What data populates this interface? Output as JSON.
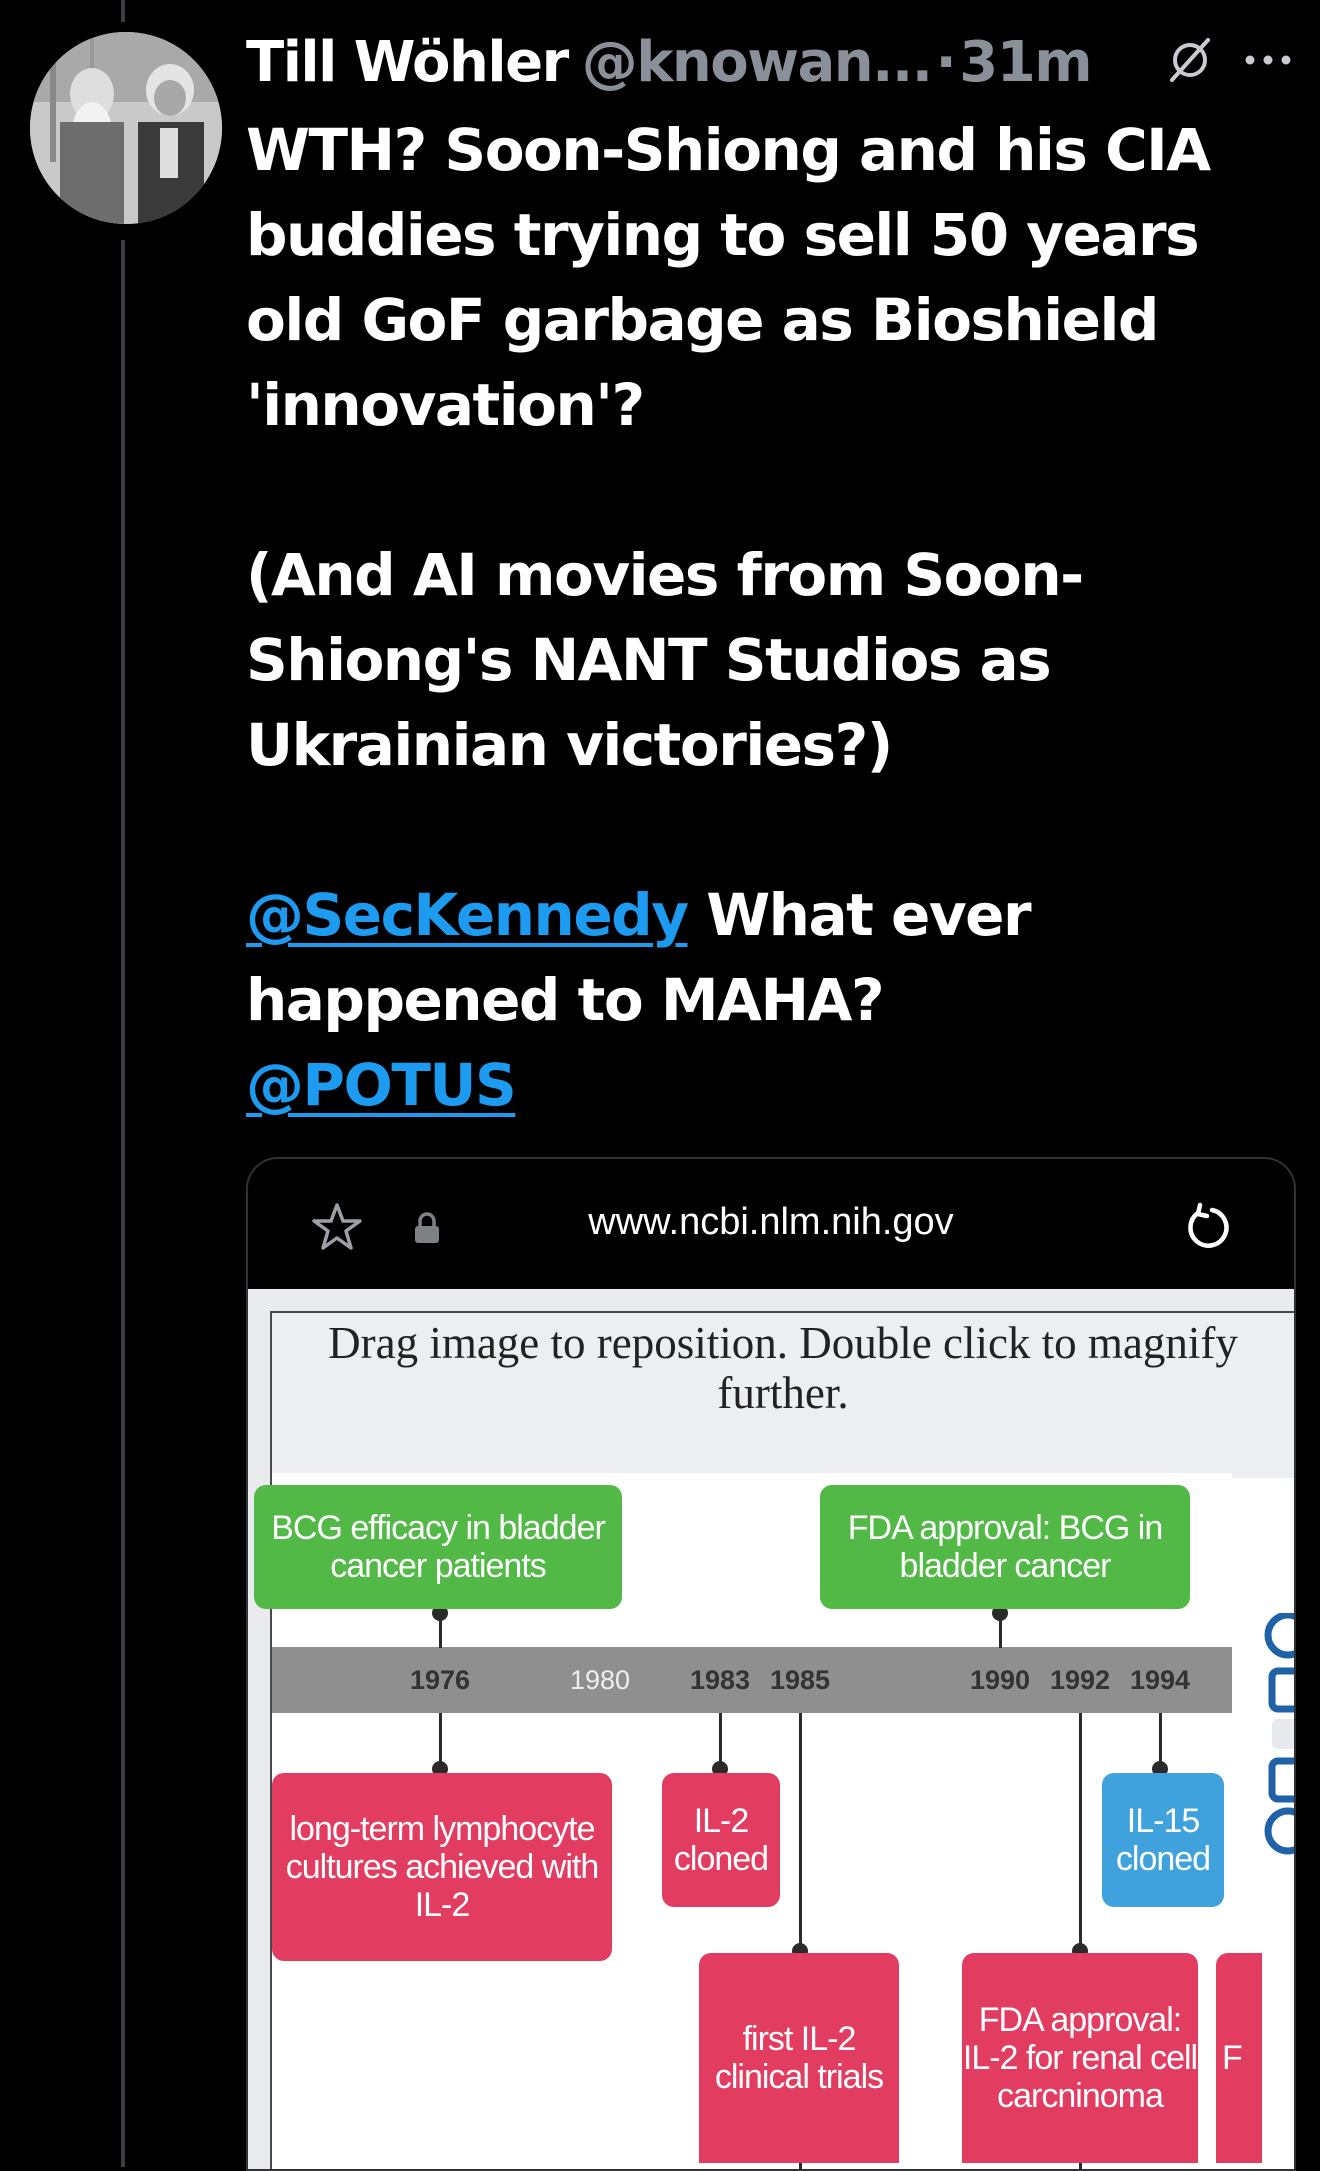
{
  "tweet": {
    "author_name": "Till Wöhler",
    "handle": "@knowan...",
    "separator": "·",
    "time": "31m",
    "paragraphs": [
      "WTH? Soon-Shiong and his CIA buddies trying to sell 50 years old GoF garbage as Bioshield 'innovation'?",
      "(And AI movies from Soon-Shiong's NANT Studios as Ukrainian victories?)"
    ],
    "mention1": "@SecKennedy",
    "mention_tail": "What ever happened to MAHA?",
    "mention2": "@POTUS"
  },
  "browser": {
    "url": "www.ncbi.nlm.nih.gov"
  },
  "viewer": {
    "hint": "Drag image to reposition. Double click to magnify further."
  },
  "timeline": {
    "years": [
      "1976",
      "1980",
      "1983",
      "1985",
      "1990",
      "1992",
      "1994"
    ],
    "top_events": [
      {
        "label": "BCG efficacy in bladder cancer patients",
        "year": "1976"
      },
      {
        "label": "FDA approval: BCG in bladder cancer",
        "year": "1990"
      }
    ],
    "bottom_events": [
      {
        "label": "long-term lymphocyte cultures achieved with IL-2",
        "year": "1976"
      },
      {
        "label": "IL-2 cloned",
        "year": "1983"
      },
      {
        "label": "IL-15 cloned",
        "year": "1994"
      },
      {
        "label": "first IL-2 clinical trials",
        "year": "1985"
      },
      {
        "label": "FDA approval: IL-2 for renal cell carcninoma",
        "year": "1992"
      },
      {
        "label": "F",
        "year": ""
      }
    ]
  },
  "icons": {
    "grok": "slashed-circle-icon",
    "more": "more-dots-icon",
    "star": "star-outline-icon",
    "lock": "lock-icon",
    "reload": "reload-icon"
  },
  "colors": {
    "background": "#000000",
    "mention": "#1d9bf0",
    "muted": "#8a9099",
    "green_box": "#52b947",
    "red_box": "#e23c61",
    "blue_box": "#3fa2dd"
  }
}
